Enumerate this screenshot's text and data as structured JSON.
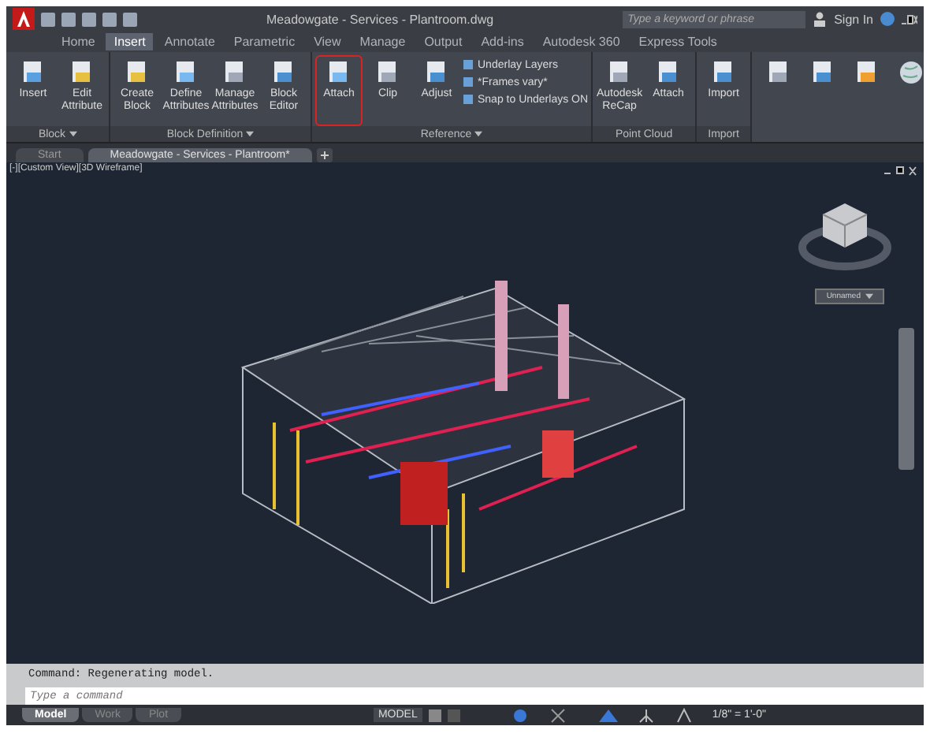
{
  "window": {
    "title": "Meadowgate - Services - Plantroom.dwg"
  },
  "search": {
    "placeholder": "Type a keyword or phrase"
  },
  "sign_in": "Sign In",
  "ribbon_tabs": [
    {
      "label": "Home",
      "selected": false
    },
    {
      "label": "Insert",
      "selected": true
    },
    {
      "label": "Annotate",
      "selected": false
    },
    {
      "label": "Parametric",
      "selected": false
    },
    {
      "label": "View",
      "selected": false
    },
    {
      "label": "Manage",
      "selected": false
    },
    {
      "label": "Output",
      "selected": false
    },
    {
      "label": "Add-ins",
      "selected": false
    },
    {
      "label": "Autodesk 360",
      "selected": false
    },
    {
      "label": "Express Tools",
      "selected": false
    }
  ],
  "panels": [
    {
      "title": "Block",
      "menu": true,
      "tools": [
        {
          "kind": "large",
          "label": "Insert",
          "highlighted": false
        },
        {
          "kind": "large",
          "label": "Edit Attribute",
          "highlighted": false
        }
      ]
    },
    {
      "title": "Block Definition",
      "menu": true,
      "tools": [
        {
          "kind": "large",
          "label": "Create Block",
          "highlighted": false
        },
        {
          "kind": "large",
          "label": "Define Attributes",
          "highlighted": false
        },
        {
          "kind": "large",
          "label": "Manage Attributes",
          "highlighted": false
        },
        {
          "kind": "large",
          "label": "Block Editor",
          "highlighted": false
        }
      ]
    },
    {
      "title": "Reference",
      "menu": true,
      "tools": [
        {
          "kind": "large",
          "label": "Attach",
          "highlighted": true
        },
        {
          "kind": "large",
          "label": "Clip",
          "highlighted": false
        },
        {
          "kind": "large",
          "label": "Adjust",
          "highlighted": false
        },
        {
          "kind": "small",
          "label": "Underlay Layers",
          "highlighted": false
        },
        {
          "kind": "small",
          "label": "*Frames vary*",
          "highlighted": false
        },
        {
          "kind": "small",
          "label": "Snap to Underlays ON",
          "highlighted": false
        }
      ]
    },
    {
      "title": "Point Cloud",
      "menu": false,
      "tools": [
        {
          "kind": "large",
          "label": "Autodesk ReCap",
          "highlighted": false
        },
        {
          "kind": "large",
          "label": "Attach",
          "highlighted": false
        }
      ]
    },
    {
      "title": "Import",
      "menu": false,
      "tools": [
        {
          "kind": "large",
          "label": "Import",
          "highlighted": false
        }
      ]
    }
  ],
  "file_tabs": [
    {
      "label": "Start",
      "selected": false
    },
    {
      "label": "Meadowgate - Services - Plantroom*",
      "selected": true
    }
  ],
  "viewport": {
    "label": "[-][Custom View][3D Wireframe]",
    "view_name": "Unnamed"
  },
  "command_line": {
    "history": "Command:  Regenerating model.",
    "placeholder": "Type a command"
  },
  "layout_tabs": [
    {
      "label": "Model",
      "selected": true
    },
    {
      "label": "Work",
      "selected": false
    },
    {
      "label": "Plot",
      "selected": false
    }
  ],
  "status_bar": {
    "mode": "MODEL",
    "scale": "1/8\" = 1'-0\""
  }
}
